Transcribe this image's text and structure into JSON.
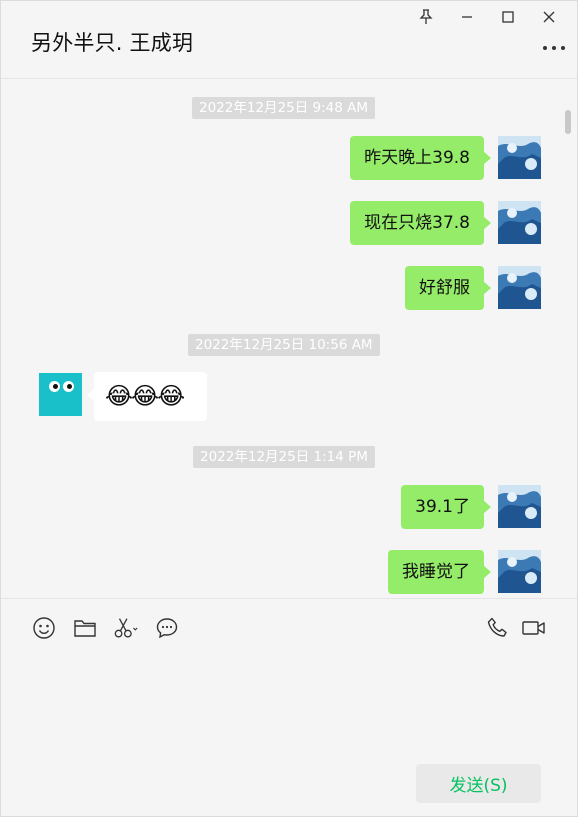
{
  "header": {
    "title": "另外半只. 王成玥"
  },
  "window_controls": {
    "pin_icon": "pin-icon",
    "minimize_icon": "minimize-icon",
    "maximize_icon": "maximize-icon",
    "close_icon": "close-icon"
  },
  "messages": [
    {
      "type": "timestamp",
      "text": "2022年12月25日 9:48 AM"
    },
    {
      "type": "sent",
      "text": "昨天晚上39.8"
    },
    {
      "type": "sent",
      "text": "现在只烧37.8"
    },
    {
      "type": "sent",
      "text": "好舒服"
    },
    {
      "type": "timestamp",
      "text": "2022年12月25日 10:56 AM"
    },
    {
      "type": "received",
      "text": "😂😂😂"
    },
    {
      "type": "timestamp",
      "text": "2022年12月25日 1:14 PM"
    },
    {
      "type": "sent",
      "text": "39.1了"
    },
    {
      "type": "sent",
      "text": "我睡觉了"
    }
  ],
  "toolbar": {
    "emoji_icon": "smiley-icon",
    "file_icon": "folder-icon",
    "screenshot_icon": "scissors-icon",
    "chat_history_icon": "chat-bubble-icon",
    "voice_call_icon": "phone-icon",
    "video_call_icon": "video-camera-icon"
  },
  "send_label": "发送(S)",
  "colors": {
    "sent_bubble": "#95ec69",
    "received_bubble": "#ffffff",
    "send_text": "#07c160",
    "background": "#f5f5f5"
  }
}
